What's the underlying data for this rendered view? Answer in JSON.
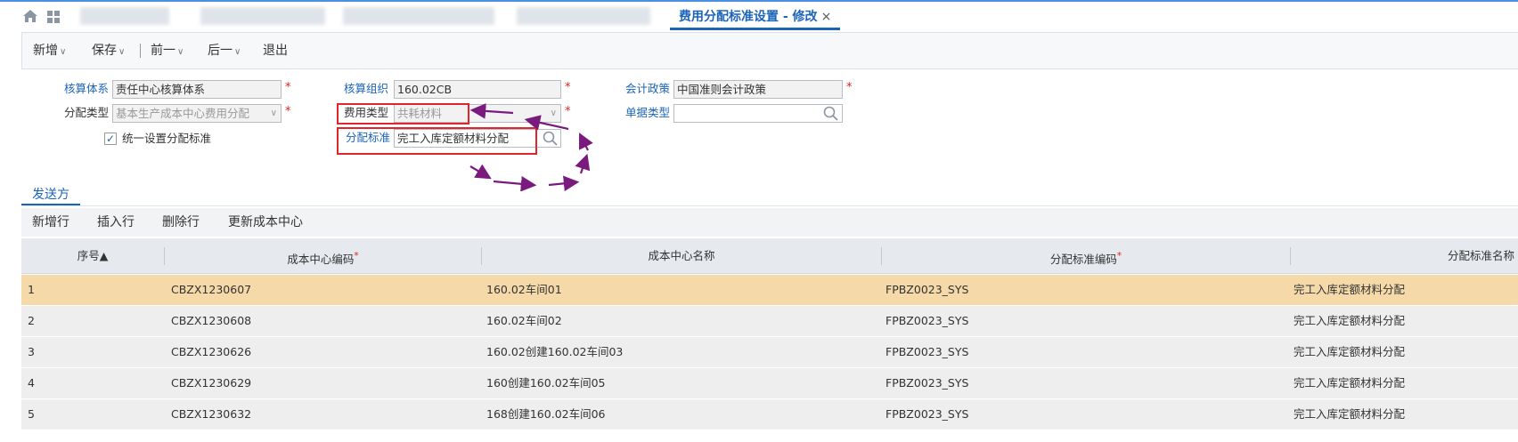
{
  "window": {
    "tab_title": "费用分配标准设置 - 修改",
    "tab_close": "×"
  },
  "toolbar": {
    "new_label": "新增",
    "save_label": "保存",
    "prev_label": "前一",
    "next_label": "后一",
    "exit_label": "退出",
    "caret": "∨"
  },
  "form": {
    "accounting_system": {
      "label": "核算体系",
      "value": "责任中心核算体系"
    },
    "accounting_org": {
      "label": "核算组织",
      "value": "160.02CB"
    },
    "accounting_policy": {
      "label": "会计政策",
      "value": "中国准则会计政策"
    },
    "allocation_type": {
      "label": "分配类型",
      "value": "基本生产成本中心费用分配"
    },
    "expense_type": {
      "label": "费用类型",
      "value": "共耗材料"
    },
    "doc_type": {
      "label": "单据类型",
      "value": ""
    },
    "unified_setting": {
      "label": "统一设置分配标准",
      "checked": true,
      "mark": "✓"
    },
    "allocation_standard": {
      "label": "分配标准",
      "value": "完工入库定额材料分配"
    },
    "required_mark": "*"
  },
  "section": {
    "tab_label": "发送方"
  },
  "grid_toolbar": {
    "add_row": "新增行",
    "insert_row": "插入行",
    "delete_row": "删除行",
    "update_cost_center": "更新成本中心"
  },
  "grid": {
    "columns": {
      "seq": "序号▲",
      "cost_center_code": "成本中心编码",
      "cost_center_name": "成本中心名称",
      "standard_code": "分配标准编码",
      "standard_name": "分配标准名称"
    },
    "rows": [
      {
        "seq": "1",
        "code": "CBZX1230607",
        "name": "160.02车间01",
        "std_code": "FPBZ0023_SYS",
        "std_name": "完工入库定额材料分配"
      },
      {
        "seq": "2",
        "code": "CBZX1230608",
        "name": "160.02车间02",
        "std_code": "FPBZ0023_SYS",
        "std_name": "完工入库定额材料分配"
      },
      {
        "seq": "3",
        "code": "CBZX1230626",
        "name": "160.02创建160.02车间03",
        "std_code": "FPBZ0023_SYS",
        "std_name": "完工入库定额材料分配"
      },
      {
        "seq": "4",
        "code": "CBZX1230629",
        "name": "160创建160.02车间05",
        "std_code": "FPBZ0023_SYS",
        "std_name": "完工入库定额材料分配"
      },
      {
        "seq": "5",
        "code": "CBZX1230632",
        "name": "168创建160.02车间06",
        "std_code": "FPBZ0023_SYS",
        "std_name": "完工入库定额材料分配"
      }
    ]
  },
  "colors": {
    "accent": "#1b64b8",
    "required": "#e02020",
    "highlight_box": "#e0262a",
    "annotation_arrow": "#7a1a7e",
    "selected_row": "#f5d9a8"
  }
}
